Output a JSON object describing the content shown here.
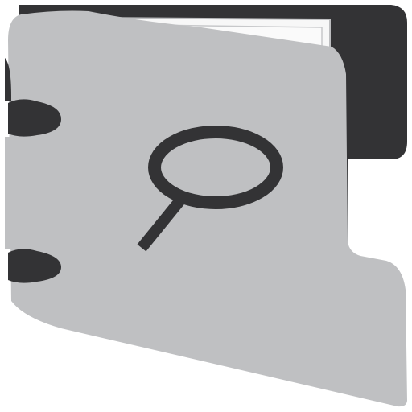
{
  "icon": {
    "name": "folder-search-icon",
    "colors": {
      "background": "#ffffff",
      "back_cover": "#333335",
      "front_cover": "#bfc0c2",
      "paper": "#f7f7f7",
      "magnifier": "#333335",
      "ring": "#333335"
    }
  }
}
